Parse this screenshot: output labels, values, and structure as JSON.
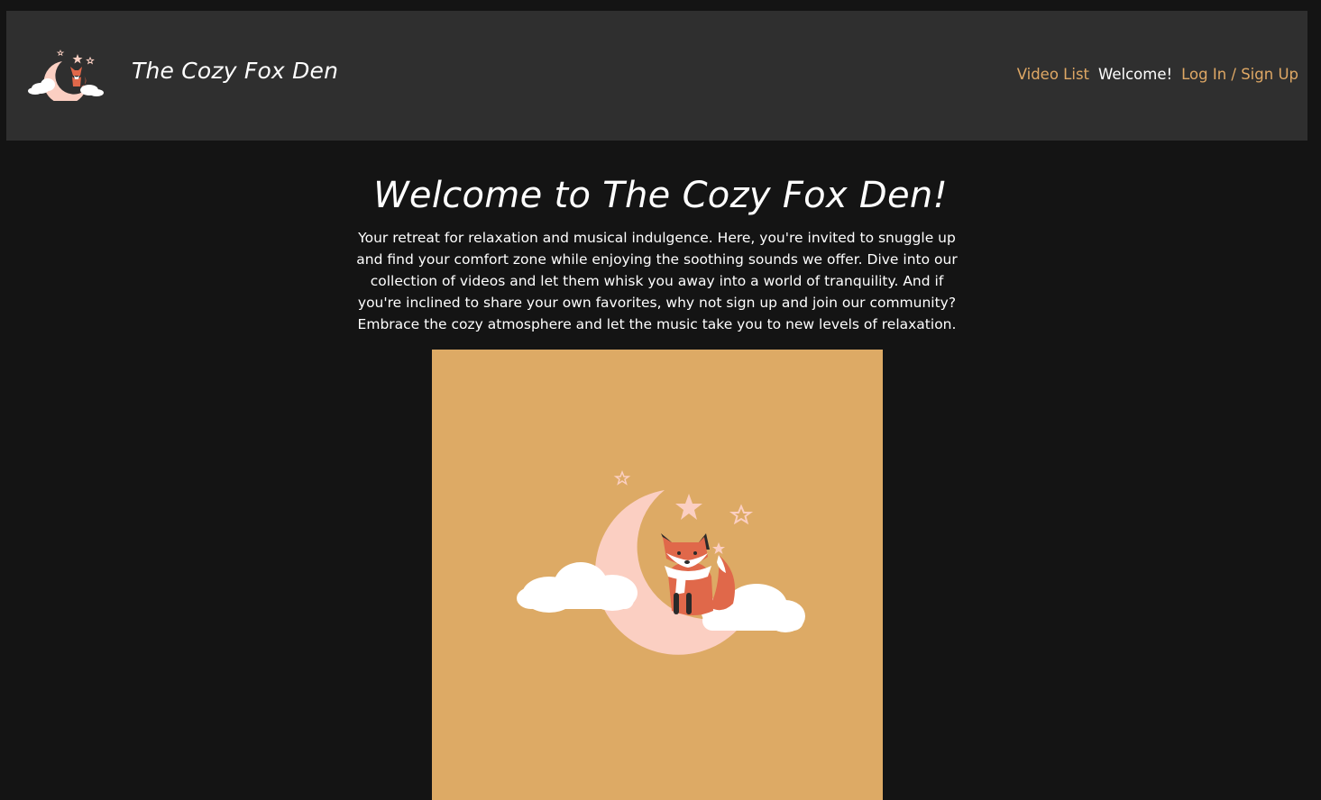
{
  "nav": {
    "brand": "The Cozy Fox Den",
    "links": {
      "video_list": "Video List",
      "welcome": "Welcome!",
      "login": "Log In / Sign Up"
    }
  },
  "main": {
    "heading": "Welcome to The Cozy Fox Den!",
    "intro": "Your retreat for relaxation and musical indulgence. Here, you're invited to snuggle up and find your comfort zone while enjoying the soothing sounds we offer. Dive into our collection of videos and let them whisk you away into a world of tranquility. And if you're inclined to share your own favorites, why not sign up and join our community? Embrace the cozy atmosphere and let the music take you to new levels of relaxation."
  },
  "colors": {
    "page_bg": "#141414",
    "navbar_bg": "#2f2f2f",
    "link": "#dfa865",
    "hero_bg": "#ddaa65",
    "moon": "#fbcfc2",
    "fox": "#e0684a"
  },
  "icons": {
    "logo": "moon-fox-logo",
    "hero": "moon-fox-illustration"
  }
}
